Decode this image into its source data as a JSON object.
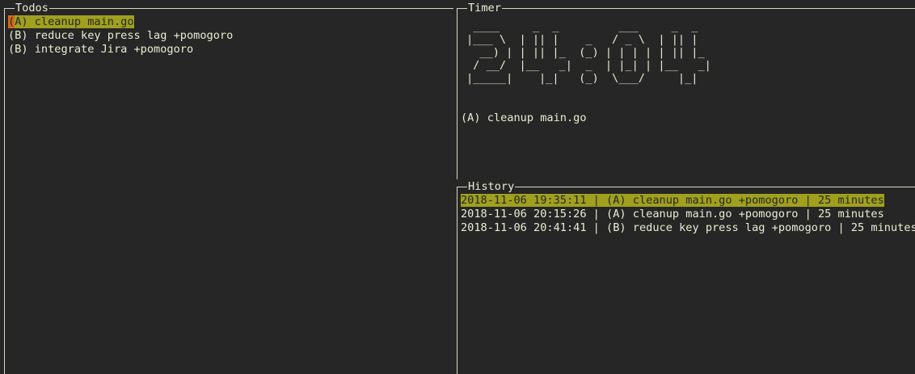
{
  "todos": {
    "title": "Todos",
    "items": [
      {
        "cursor": "(",
        "rest": "A) cleanup main.go",
        "selected": true
      },
      {
        "cursor": "",
        "rest": "(B) reduce key press lag +pomogoro",
        "selected": false
      },
      {
        "cursor": "",
        "rest": "(B) integrate Jira +pomogoro",
        "selected": false
      }
    ]
  },
  "timer": {
    "title": "Timer",
    "ascii_clock": " ____     _  _         ___     _  _\n|___ \\  | || |    _   / _ \\  | || |\n  __) | | || |_  (_) | | | | | || |_\n / __/  |__   _|  _  | |_| | |__   _|\n|_____|    |_|   (_)  \\___/     |_|",
    "current_task": "(A) cleanup main.go"
  },
  "history": {
    "title": "History",
    "entries": [
      {
        "text": "2018-11-06 19:35:11 | (A) cleanup main.go +pomogoro | 25 minutes",
        "selected": true
      },
      {
        "text": "2018-11-06 20:15:26 | (A) cleanup main.go +pomogoro | 25 minutes",
        "selected": false
      },
      {
        "text": "2018-11-06 20:41:41 | (B) reduce key press lag +pomogoro | 25 minutes",
        "selected": false
      }
    ]
  },
  "colors": {
    "background": "#262626",
    "foreground": "#ebebd3",
    "border": "#d9d9c5",
    "selection": "#a0a01e",
    "cursor": "#d2691e"
  }
}
